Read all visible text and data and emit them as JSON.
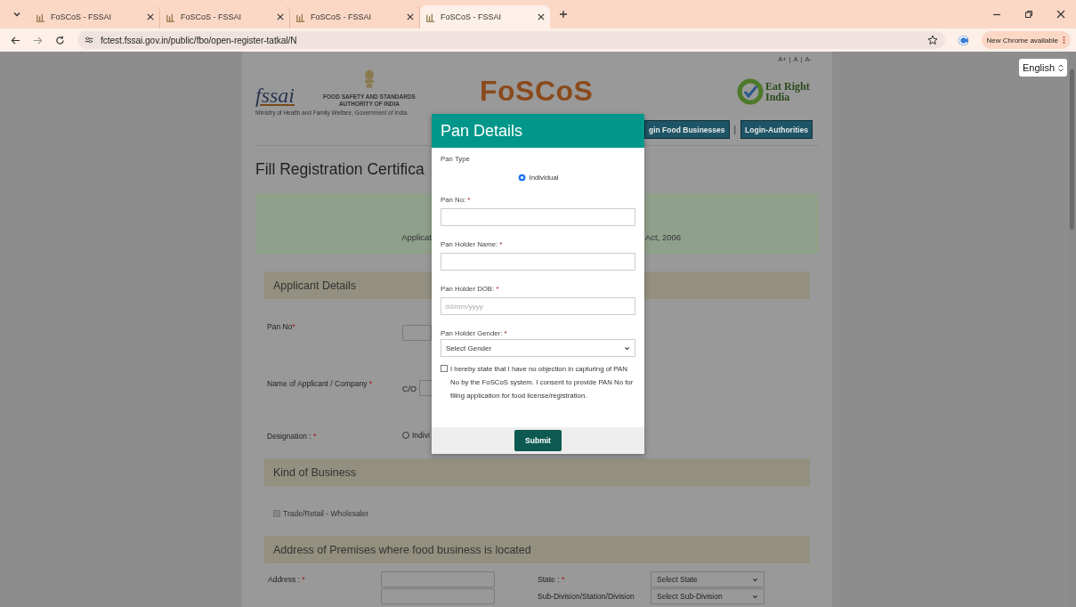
{
  "browser": {
    "tabs": [
      {
        "title": "FoSCoS - FSSAI",
        "selected": false
      },
      {
        "title": "FoSCoS - FSSAI",
        "selected": false
      },
      {
        "title": "FoSCoS - FSSAI",
        "selected": false
      },
      {
        "title": "FoSCoS - FSSAI",
        "selected": true
      }
    ],
    "url": "fctest.fssai.gov.in/public/fbo/open-register-tatkal/N",
    "update_button": "New Chrome available"
  },
  "language_select": {
    "value": "English"
  },
  "header": {
    "font_size_controls": [
      "A+",
      "A",
      "A-"
    ],
    "font_size_separators": [
      "|",
      "|"
    ],
    "fssai_logo": "fssai",
    "org_name": [
      "FOOD SAFETY AND STANDARDS",
      "AUTHORITY OF INDIA"
    ],
    "ministry": "Ministry of Health and Family Welfare, Government of India",
    "brand": "FoSCoS",
    "eat_right": "Eat Right India",
    "nav_buttons": [
      "gin Food Businesses",
      "Login-Authorities"
    ],
    "separator": "|"
  },
  "page_title": "Fill Registration Certifica",
  "notice": {
    "left": "Applicat",
    "right": "Act, 2006"
  },
  "applicant": {
    "title": "Applicant Details",
    "pan_label": "Pan No",
    "pan_mark": "*",
    "name_label": "Name of Applicant / Company",
    "name_mark": "*",
    "co_label": "C/O",
    "designation_label": "Designation :",
    "designation_mark": "*",
    "designation_option": {
      "label": "Indivi",
      "selected": false
    }
  },
  "business": {
    "title": "Kind of Business",
    "option": {
      "label": "Trade/Retail - Wholesaler",
      "disabled": true
    }
  },
  "premises": {
    "title": "Address of Premises where food business is located",
    "address_label": "Address :",
    "address_mark": "*",
    "state_label": "State :",
    "state_mark": "*",
    "state_value": "Select State",
    "subdivision_label": "Sub-Division/Station/Division",
    "subdivision_value": "Select Sub-Division"
  },
  "modal": {
    "title": "Pan Details",
    "pan_type_label": "Pan Type",
    "pan_type_options": [
      {
        "label": "Individual",
        "selected": true
      }
    ],
    "fields": [
      {
        "kind": "text",
        "label": "Pan No:",
        "required_mark": "*"
      },
      {
        "kind": "text",
        "label": "Pan Holder Name:",
        "required_mark": "*"
      },
      {
        "kind": "text",
        "label": "Pan Holder DOB:",
        "required_mark": "*",
        "placeholder": "dd/mm/yyyy"
      },
      {
        "kind": "select",
        "label": "Pan Holder Gender:",
        "required_mark": "*",
        "value": "Select Gender"
      }
    ],
    "consent": {
      "text": "I hereby state that I have no objection in capturing of PAN No by the FoSCoS system. I consent to provide PAN No for filing application for food license/registration.",
      "checked": false
    },
    "submit": "Submit"
  }
}
